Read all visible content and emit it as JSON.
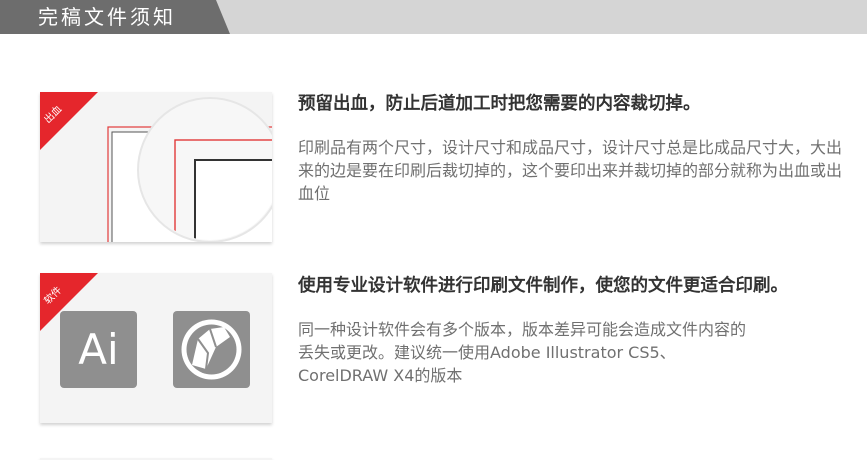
{
  "header": {
    "title": "完稿文件须知"
  },
  "sections": [
    {
      "badge": "出血",
      "title": "预留出血，防止后道加工时把您需要的内容裁切掉。",
      "body": "印刷品有两个尺寸，设计尺寸和成品尺寸，设计尺寸总是比成品尺寸大，大出来的边是要在印刷后裁切掉的，这个要印出来并裁切掉的部分就称为出血或出血位"
    },
    {
      "badge": "软件",
      "title": "使用专业设计软件进行印刷文件制作，使您的文件更适合印刷。",
      "body_lines": [
        "同一种设计软件会有多个版本，版本差异可能会造成文件内容的",
        "丢失或更改。建议统一使用Adobe Illustrator CS5、",
        "CorelDRAW X4的版本"
      ],
      "app_icons": [
        {
          "label": "Ai",
          "icon": "illustrator-icon"
        },
        {
          "label": "",
          "icon": "coreldraw-icon"
        }
      ]
    }
  ],
  "colors": {
    "accent": "#e5262c",
    "header_bg": "#d5d5d5",
    "header_tab": "#6d6d6d",
    "icon_gray": "#8f8f8f"
  }
}
